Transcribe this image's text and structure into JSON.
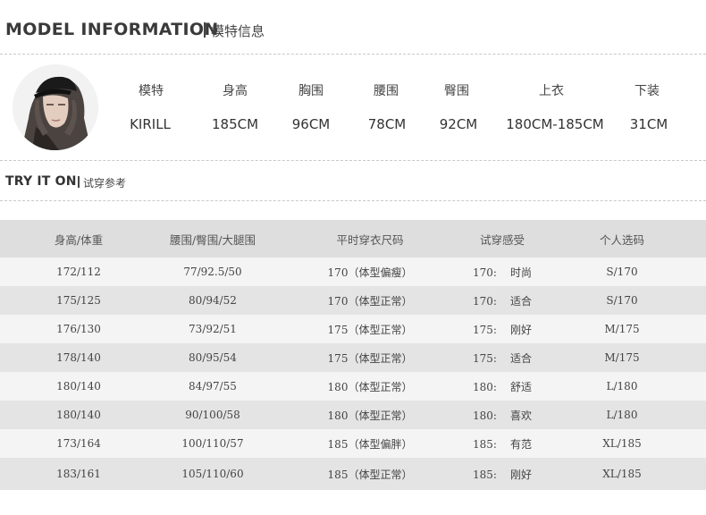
{
  "header": {
    "title_en": "MODEL INFORMATION",
    "title_cn": "模特信息"
  },
  "model": {
    "columns": [
      "模特",
      "身高",
      "胸围",
      "腰围",
      "臀围",
      "上衣",
      "下装"
    ],
    "values": [
      "KIRILL",
      "185CM",
      "96CM",
      "78CM",
      "92CM",
      "180CM-185CM",
      "31CM"
    ]
  },
  "try_on": {
    "title_en": "TRY IT ON",
    "title_cn": "试穿参考"
  },
  "table": {
    "headers": [
      "身高/体重",
      "腰围/臀围/大腿围",
      "平时穿衣尺码",
      "试穿感受",
      "个人选码"
    ],
    "rows": [
      [
        "172/112",
        "77/92.5/50",
        "170（体型偏瘦）",
        "170:",
        "时尚",
        "S/170"
      ],
      [
        "175/125",
        "80/94/52",
        "170（体型正常）",
        "170:",
        "适合",
        "S/170"
      ],
      [
        "176/130",
        "73/92/51",
        "175（体型正常）",
        "175:",
        "刚好",
        "M/175"
      ],
      [
        "178/140",
        "80/95/54",
        "175（体型正常）",
        "175:",
        "适合",
        "M/175"
      ],
      [
        "180/140",
        "84/97/55",
        "180（体型正常）",
        "180:",
        "舒适",
        "L/180"
      ],
      [
        "180/140",
        "90/100/58",
        "180（体型正常）",
        "180:",
        "喜欢",
        "L/180"
      ],
      [
        "173/164",
        "100/110/57",
        "185（体型偏胖）",
        "185:",
        "有范",
        "XL/185"
      ],
      [
        "183/161",
        "105/110/60",
        "185（体型正常）",
        "185:",
        "刚好",
        "XL/185"
      ]
    ]
  }
}
